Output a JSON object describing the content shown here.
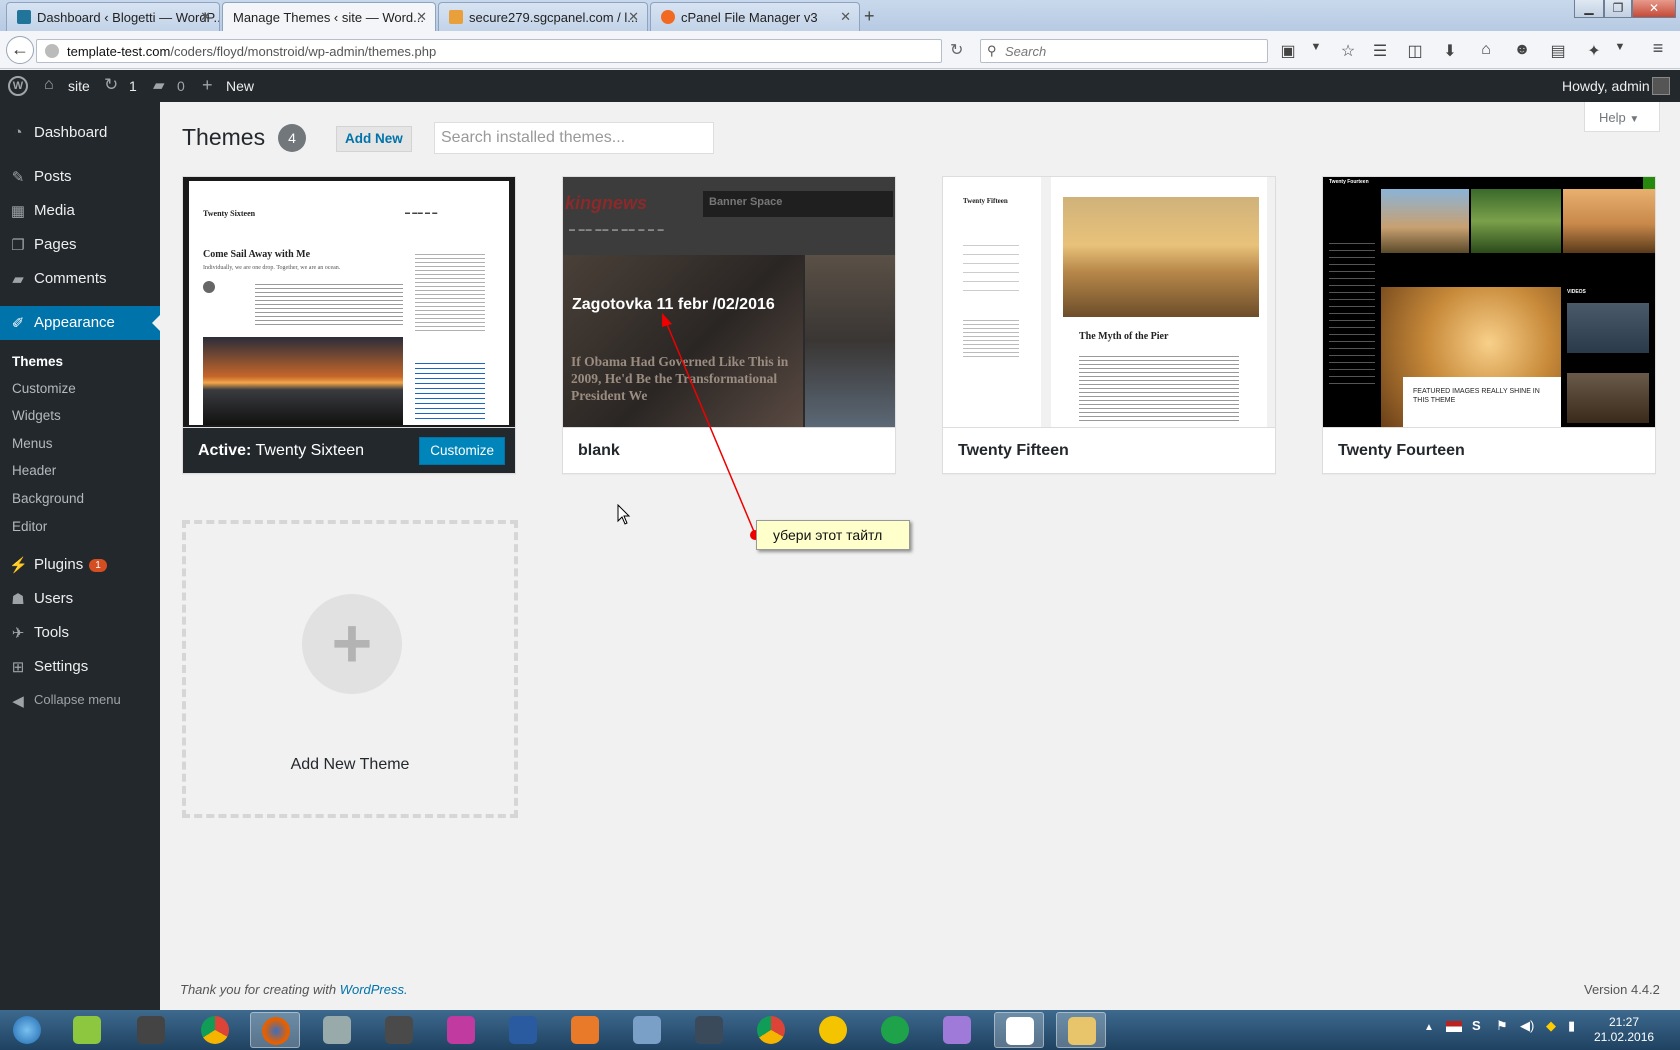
{
  "browser": {
    "tabs": [
      {
        "label": "Dashboard ‹ Blogetti — WordP...",
        "active": false
      },
      {
        "label": "Manage Themes ‹ site — Word...",
        "active": true
      },
      {
        "label": "secure279.sgcpanel.com / l...",
        "active": false
      },
      {
        "label": "cPanel File Manager v3",
        "active": false
      }
    ],
    "url_host": "template-test.com",
    "url_path": "/coders/floyd/monstroid/wp-admin/themes.php",
    "search_placeholder": "Search"
  },
  "adminbar": {
    "site": "site",
    "updates": "1",
    "comments": "0",
    "new": "New",
    "howdy": "Howdy, admin"
  },
  "sidebar": {
    "items": [
      {
        "label": "Dashboard",
        "icon": "dashboard-icon"
      },
      {
        "label": "Posts",
        "icon": "pin-icon"
      },
      {
        "label": "Media",
        "icon": "media-icon"
      },
      {
        "label": "Pages",
        "icon": "pages-icon"
      },
      {
        "label": "Comments",
        "icon": "comment-icon"
      },
      {
        "label": "Appearance",
        "icon": "brush-icon"
      },
      {
        "label": "Plugins",
        "icon": "plugin-icon"
      },
      {
        "label": "Users",
        "icon": "users-icon"
      },
      {
        "label": "Tools",
        "icon": "wrench-icon"
      },
      {
        "label": "Settings",
        "icon": "settings-icon"
      },
      {
        "label": "Collapse menu",
        "icon": "collapse-icon"
      }
    ],
    "plugins_badge": "1",
    "submenu": [
      "Themes",
      "Customize",
      "Widgets",
      "Menus",
      "Header",
      "Background",
      "Editor"
    ]
  },
  "main": {
    "title": "Themes",
    "count": "4",
    "add_new": "Add New",
    "search_placeholder": "Search installed themes...",
    "help": "Help",
    "themes": [
      {
        "name": "Twenty Sixteen",
        "active_prefix": "Active:",
        "customize": "Customize"
      },
      {
        "name": "blank"
      },
      {
        "name": "Twenty Fifteen"
      },
      {
        "name": "Twenty Fourteen"
      }
    ],
    "add_new_theme": "Add New Theme",
    "previews": {
      "sixteen_title": "Twenty Sixteen",
      "sixteen_post": "Come Sail Away with Me",
      "sixteen_sub": "Individually, we are one drop. Together, we are an ocean.",
      "blank_logo": "kingnews",
      "blank_banner": "Banner Space",
      "blank_overlay": "Zagotovka 11 febr /02/2016",
      "blank_headline": "If Obama Had Governed Like This in 2009, He'd Be the Transformational President We",
      "fifteen_title": "Twenty Fifteen",
      "fifteen_post": "The Myth of the Pier",
      "fourteen_title": "Twenty Fourteen",
      "fourteen_caption": "FEATURED IMAGES REALLY SHINE IN THIS THEME",
      "fourteen_videos": "VIDEOS"
    }
  },
  "annotation": "убери этот тайтл",
  "footer": {
    "thanks": "Thank you for creating with",
    "link": "WordPress.",
    "version": "Version 4.4.2"
  },
  "taskbar": {
    "time": "21:27",
    "date": "21.02.2016"
  },
  "colors": {
    "admin_dark": "#23282d",
    "wp_blue": "#0073aa",
    "button_blue": "#0085ba",
    "badge_orange": "#d54e21"
  }
}
